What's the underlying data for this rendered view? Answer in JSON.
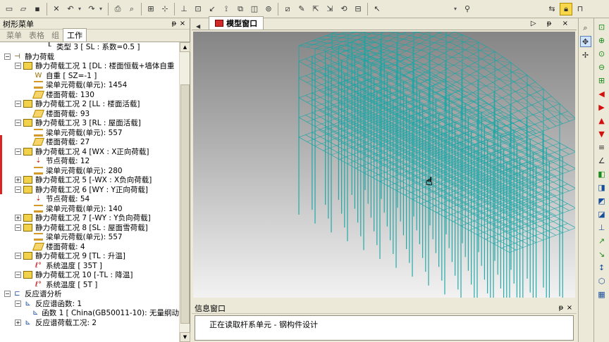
{
  "toolbar": {
    "icons": [
      "new-icon",
      "open-icon",
      "save-icon",
      "cut-icon",
      "undo-icon",
      "redo-icon",
      "print-icon",
      "print-preview-icon",
      "model-icon",
      "node-icon",
      "support-icon",
      "section-icon",
      "load-icon",
      "analysis-icon",
      "result-icon",
      "check-icon",
      "design-icon",
      "cursor-icon",
      "select-icon",
      "pan-icon",
      "rotate-icon",
      "snap-icon",
      "lock-icon"
    ],
    "dropdown_value": ""
  },
  "left_panel": {
    "title": "树形菜单",
    "pin": "ᵽ",
    "close": "×",
    "tabs": [
      "菜单",
      "表格",
      "组",
      "工作"
    ],
    "active_tab": "工作",
    "tree": [
      {
        "depth": 3,
        "exp": "",
        "icon": "type",
        "glyph": "┖",
        "text": "类型 3 [ SL : 系数=0.5 ]"
      },
      {
        "depth": 0,
        "exp": "−",
        "icon": "static",
        "glyph": "⊣",
        "text": "静力荷载"
      },
      {
        "depth": 1,
        "exp": "−",
        "icon": "case",
        "glyph": "",
        "text": "静力荷载工况 1 [DL : 楼面恒载+墙体自重"
      },
      {
        "depth": 2,
        "exp": "",
        "icon": "self",
        "glyph": "W",
        "text": "自重 [ SZ=-1 ]"
      },
      {
        "depth": 2,
        "exp": "",
        "icon": "beam",
        "glyph": "",
        "text": "梁单元荷载(单元): 1454"
      },
      {
        "depth": 2,
        "exp": "",
        "icon": "floor",
        "glyph": "",
        "text": "楼面荷载: 130"
      },
      {
        "depth": 1,
        "exp": "−",
        "icon": "case",
        "glyph": "",
        "text": "静力荷载工况 2 [LL : 楼面活载]"
      },
      {
        "depth": 2,
        "exp": "",
        "icon": "floor",
        "glyph": "",
        "text": "楼面荷载: 93"
      },
      {
        "depth": 1,
        "exp": "−",
        "icon": "case",
        "glyph": "",
        "text": "静力荷载工况 3 [RL : 屋面活载]"
      },
      {
        "depth": 2,
        "exp": "",
        "icon": "beam",
        "glyph": "",
        "text": "梁单元荷载(单元): 557"
      },
      {
        "depth": 2,
        "exp": "",
        "icon": "floor",
        "glyph": "",
        "text": "楼面荷载: 27"
      },
      {
        "depth": 1,
        "exp": "−",
        "icon": "case",
        "glyph": "",
        "text": "静力荷载工况 4 [WX : X正向荷载]"
      },
      {
        "depth": 2,
        "exp": "",
        "icon": "node",
        "glyph": "⇣",
        "text": "节点荷载: 12"
      },
      {
        "depth": 2,
        "exp": "",
        "icon": "beam",
        "glyph": "",
        "text": "梁单元荷载(单元): 280"
      },
      {
        "depth": 1,
        "exp": "+",
        "icon": "case",
        "glyph": "",
        "text": "静力荷载工况 5 [-WX : X负向荷载]"
      },
      {
        "depth": 1,
        "exp": "−",
        "icon": "case",
        "glyph": "",
        "text": "静力荷载工况 6 [WY : Y正向荷载]"
      },
      {
        "depth": 2,
        "exp": "",
        "icon": "node",
        "glyph": "⇣",
        "text": "节点荷载: 54"
      },
      {
        "depth": 2,
        "exp": "",
        "icon": "beam",
        "glyph": "",
        "text": "梁单元荷载(单元): 140"
      },
      {
        "depth": 1,
        "exp": "+",
        "icon": "case",
        "glyph": "",
        "text": "静力荷载工况 7 [-WY : Y负向荷载]"
      },
      {
        "depth": 1,
        "exp": "−",
        "icon": "case",
        "glyph": "",
        "text": "静力荷载工况 8 [SL : 屋面雪荷载]"
      },
      {
        "depth": 2,
        "exp": "",
        "icon": "beam",
        "glyph": "",
        "text": "梁单元荷载(单元): 557"
      },
      {
        "depth": 2,
        "exp": "",
        "icon": "floor",
        "glyph": "",
        "text": "楼面荷载: 4"
      },
      {
        "depth": 1,
        "exp": "−",
        "icon": "case",
        "glyph": "",
        "text": "静力荷载工况 9 [TL : 升温]"
      },
      {
        "depth": 2,
        "exp": "",
        "icon": "temp",
        "glyph": "ℓ°",
        "text": "系统温度 [ 35T ]"
      },
      {
        "depth": 1,
        "exp": "−",
        "icon": "case",
        "glyph": "",
        "text": "静力荷载工况 10 [-TL : 降温]"
      },
      {
        "depth": 2,
        "exp": "",
        "icon": "temp",
        "glyph": "ℓ°",
        "text": "系统温度 [ 5T ]"
      },
      {
        "depth": 0,
        "exp": "−",
        "icon": "resp",
        "glyph": "⊏",
        "text": "反应谱分析"
      },
      {
        "depth": 1,
        "exp": "−",
        "icon": "resp",
        "glyph": "⊾",
        "text": "反应谱函数: 1"
      },
      {
        "depth": 2,
        "exp": "",
        "icon": "resp",
        "glyph": "⊾",
        "text": "函数 1 [ China(GB50011-10): 无量纲动"
      },
      {
        "depth": 1,
        "exp": "+",
        "icon": "resp",
        "glyph": "⊾",
        "text": "反应谱荷载工况: 2"
      }
    ]
  },
  "model_window": {
    "tab_label": "模型窗口",
    "nav_left": "◀",
    "nav_right": "▷ ᵽ ×"
  },
  "info_window": {
    "title": "信息窗口",
    "pin": "ᵽ",
    "close": "×",
    "message": "正在读取杆系单元 - 钢构件设计"
  },
  "right_toolbar": {
    "icons": [
      "zoom-icon",
      "move-icon",
      "rotate3d-icon"
    ]
  },
  "right_toolbar2": {
    "icons": [
      "zoom-window-icon",
      "zoom-in-icon",
      "zoom-fit-icon",
      "zoom-out-icon",
      "zoom-all-icon",
      "arrow-left-icon",
      "arrow-right-icon",
      "arrow-up-icon",
      "arrow-down-icon",
      "ruler-icon",
      "angle-icon",
      "cube-front-icon",
      "cube-top-icon",
      "cube-side-icon",
      "cube-iso-icon",
      "axis-icon",
      "axis-x-icon",
      "axis-y-icon",
      "axis-z-icon",
      "view-iso-icon",
      "view-plane-icon"
    ]
  },
  "colors": {
    "structure": "#1aa6a6",
    "accent_red": "#d12a2a",
    "panel_bg": "#ece9d8"
  }
}
